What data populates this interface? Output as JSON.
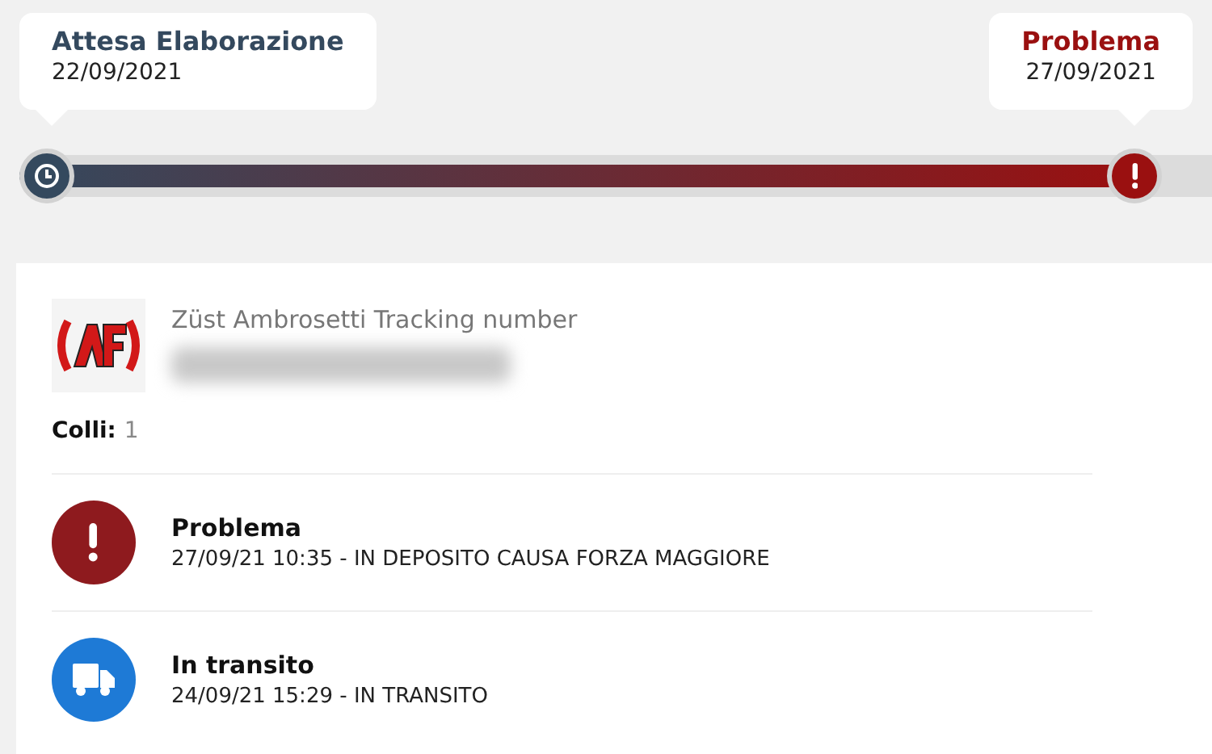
{
  "timeline": {
    "level": 0.935,
    "stages": [
      {
        "kind": "waiting",
        "title": "Attesa Elaborazione",
        "date": "22/09/2021"
      },
      {
        "kind": "problem",
        "title": "Problema",
        "date": "27/09/2021"
      }
    ]
  },
  "shipment": {
    "carrier_label": "Züst Ambrosetti Tracking number",
    "colli_label": "Colli:",
    "colli_value": "1"
  },
  "events": [
    {
      "kind": "problem",
      "title": "Problema",
      "detail": "27/09/21 10:35 - IN DEPOSITO CAUSA FORZA MAGGIORE"
    },
    {
      "kind": "transit",
      "title": "In transito",
      "detail": "24/09/21 15:29 - IN TRANSITO"
    }
  ]
}
